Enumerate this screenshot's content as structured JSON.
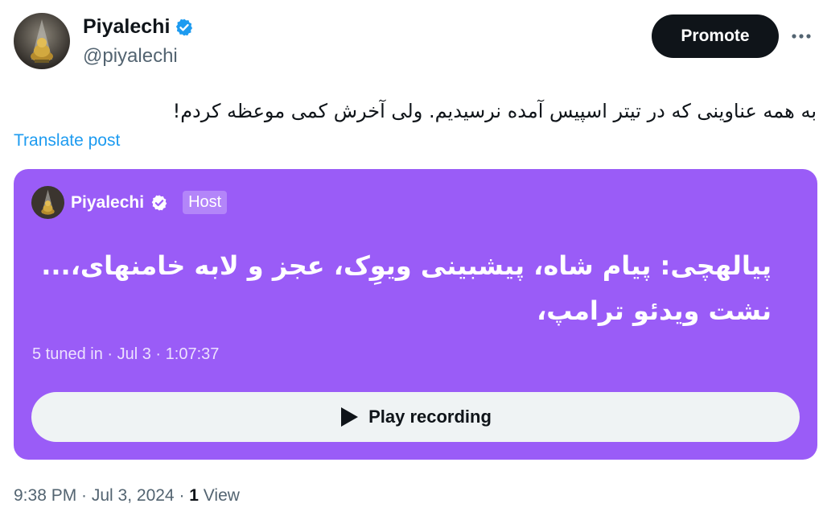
{
  "author": {
    "name": "Piyalechi",
    "handle": "@piyalechi",
    "avatar_icon": "chess-figure-avatar",
    "verified_color": "#1d9bf0"
  },
  "header": {
    "promote_label": "Promote",
    "more_icon": "more-dots-icon"
  },
  "tweet": {
    "text": "به همه عناوینی که در تیتر اسپیس آمده نرسیدیم. ولی آخرش کمی موعظه کردم!",
    "translate_label": "Translate post"
  },
  "space_card": {
    "background_color": "#9a5cf7",
    "host_name": "Piyalechi",
    "host_badge": "Host",
    "title": "پیالهچی: پیام شاه، پیشبینی ویوِک، عجز و لابه خامنهای،... نشت ویدئو ترامپ،",
    "meta": "5 tuned in · Jul 3 · 1:07:37",
    "play_label": "Play recording",
    "play_icon": "play-icon"
  },
  "footer": {
    "datetime": "9:38 PM · Jul 3, 2024 · ",
    "views_count": "1",
    "views_label": " View"
  }
}
